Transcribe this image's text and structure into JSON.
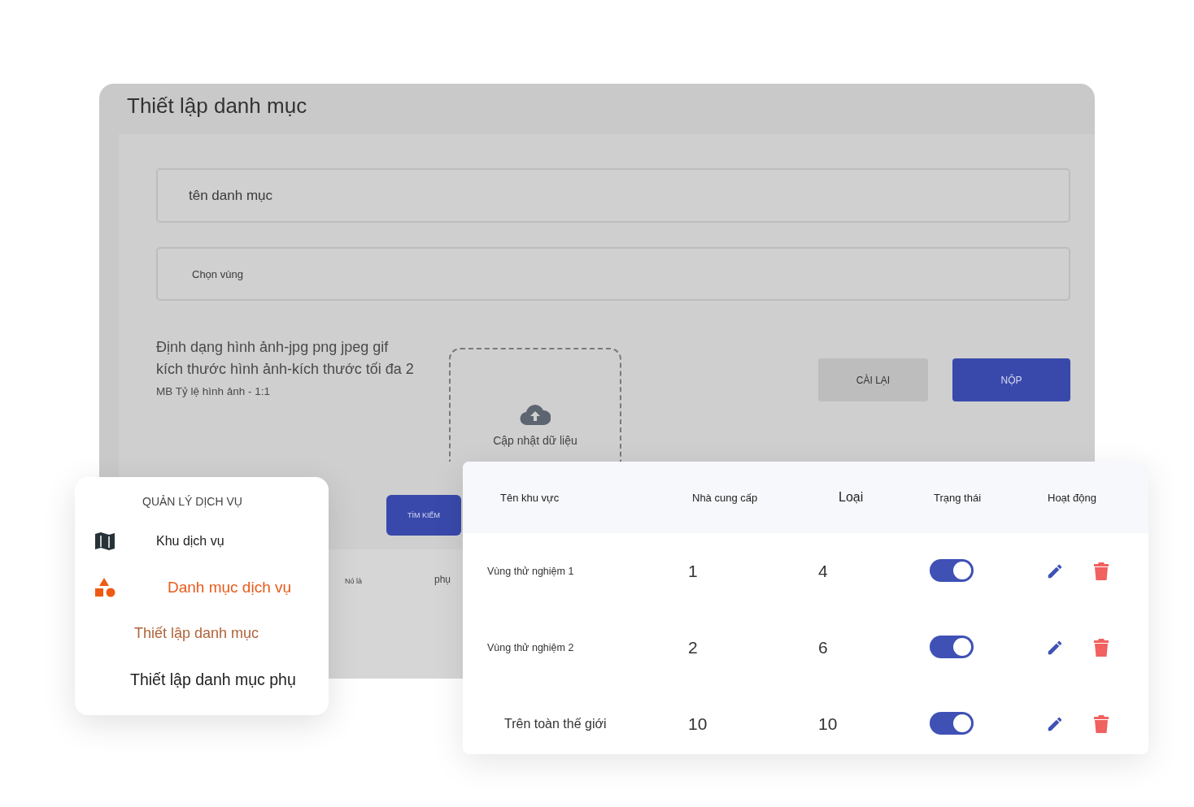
{
  "form": {
    "title": "Thiết lập danh mục",
    "fields": [
      {
        "placeholder": "tên danh mục"
      },
      {
        "placeholder": "Chọn vùng"
      }
    ],
    "upload_hint": {
      "lines": [
        "Định dạng hình ảnh-jpg png jpeg gif",
        "kích thước hình ảnh-kích thước tối đa 2"
      ],
      "note": "MB Tỷ lệ hình ảnh - 1:1"
    },
    "upload": {
      "label": "Cập nhật dữ liệu"
    },
    "buttons": [
      {
        "label": "CÀI LẠI",
        "kind": "secondary"
      },
      {
        "label": "NỘP",
        "kind": "primary"
      }
    ],
    "search_button": "TÌM KIẾM",
    "list_texts": [
      "Nó là",
      "phụ"
    ]
  },
  "sidebar": {
    "title": "QUẢN LÝ DỊCH VỤ",
    "items": [
      {
        "label": "Khu dịch vụ",
        "selected": false
      },
      {
        "label": "Danh mục dịch vụ",
        "selected": true,
        "children": [
          {
            "label": "Thiết lập danh mục",
            "selected": true
          },
          {
            "label": "Thiết lập danh mục phụ",
            "selected": false
          }
        ]
      }
    ]
  },
  "table": {
    "columns": [
      "Tên khu vực",
      "Nhà cung cấp",
      "Loại",
      "Trạng thái",
      "Hoạt động"
    ],
    "rows": [
      {
        "name": "Vùng thử nghiệm 1",
        "provider": "1",
        "type": "4",
        "on": true
      },
      {
        "name": "Vùng thử nghiệm 2",
        "provider": "2",
        "type": "6",
        "on": true
      },
      {
        "name": "Trên toàn thế giới",
        "provider": "10",
        "type": "10",
        "on": true
      }
    ]
  }
}
